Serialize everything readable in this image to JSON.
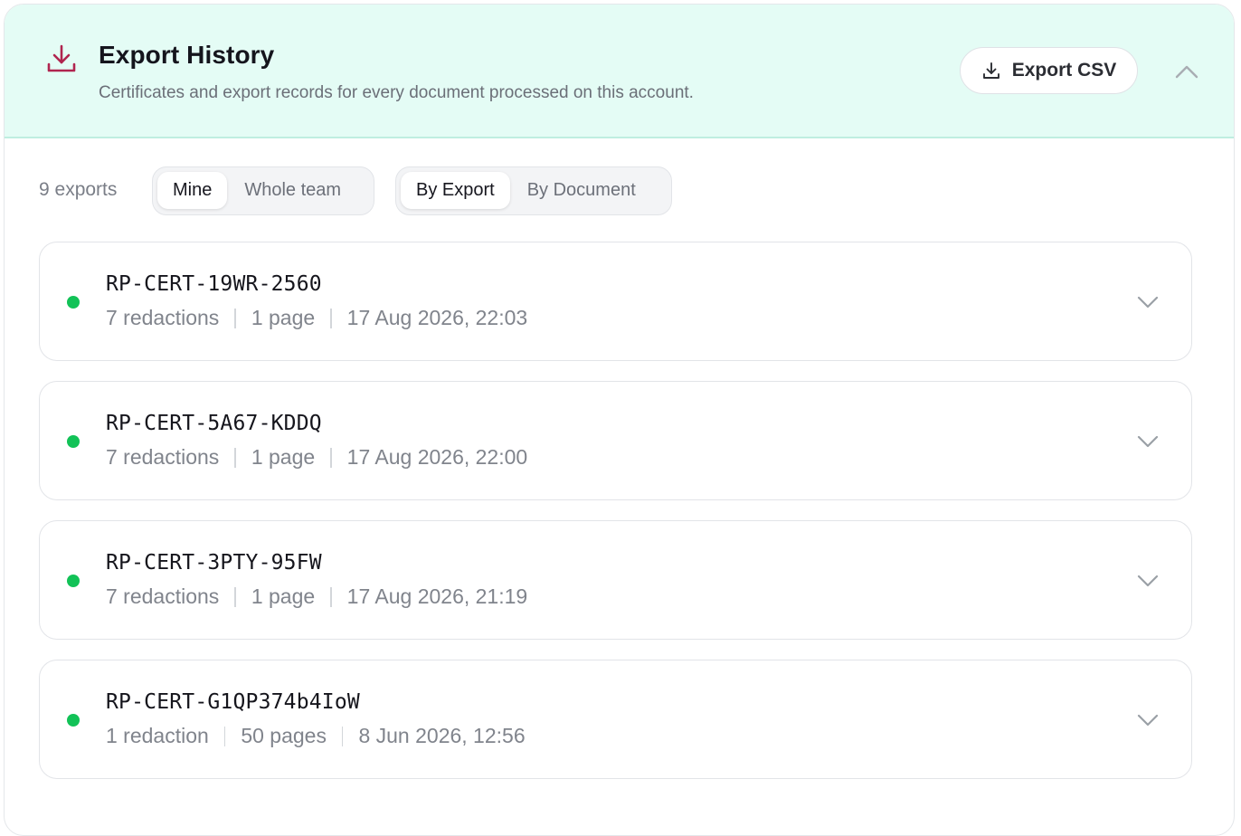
{
  "header": {
    "icon": "download-icon",
    "title": "Export History",
    "subtitle": "Certificates and export records for every document processed on this account.",
    "export_csv_label": "Export CSV",
    "accent_color": "#b0254f"
  },
  "toolbar": {
    "count_label": "9 exports",
    "owner_filter": {
      "options": [
        "Mine",
        "Whole team"
      ],
      "selected": "Mine"
    },
    "view_filter": {
      "options": [
        "By Export",
        "By Document"
      ],
      "selected": "By Export"
    }
  },
  "exports": [
    {
      "cert_id": "RP-CERT-19WR-2560",
      "redactions": "7 redactions",
      "pages": "1 page",
      "timestamp": "17 Aug 2026, 22:03",
      "status_color": "#12c257"
    },
    {
      "cert_id": "RP-CERT-5A67-KDDQ",
      "redactions": "7 redactions",
      "pages": "1 page",
      "timestamp": "17 Aug 2026, 22:00",
      "status_color": "#12c257"
    },
    {
      "cert_id": "RP-CERT-3PTY-95FW",
      "redactions": "7 redactions",
      "pages": "1 page",
      "timestamp": "17 Aug 2026, 21:19",
      "status_color": "#12c257"
    },
    {
      "cert_id": "RP-CERT-G1QP374b4IoW",
      "redactions": "1 redaction",
      "pages": "50 pages",
      "timestamp": "8 Jun 2026, 12:56",
      "status_color": "#12c257"
    }
  ]
}
